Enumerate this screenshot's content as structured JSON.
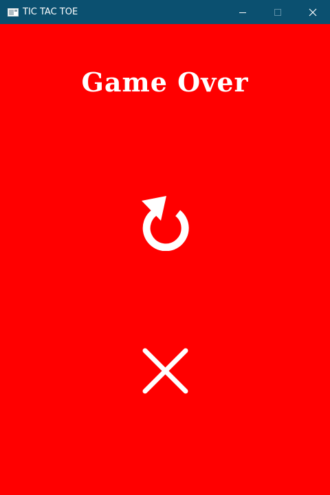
{
  "window": {
    "title": "TIC TAC TOE",
    "app_icon": "window-icon",
    "controls": {
      "minimize_icon": "minimize-icon",
      "maximize_icon": "maximize-icon",
      "close_icon": "close-icon"
    },
    "titlebar_color": "#0b5070"
  },
  "screen": {
    "background_color": "#ff0000",
    "heading": "Game Over",
    "restart_icon": "restart-icon",
    "quit_icon": "close-x-icon",
    "foreground_color": "#ffffff"
  }
}
